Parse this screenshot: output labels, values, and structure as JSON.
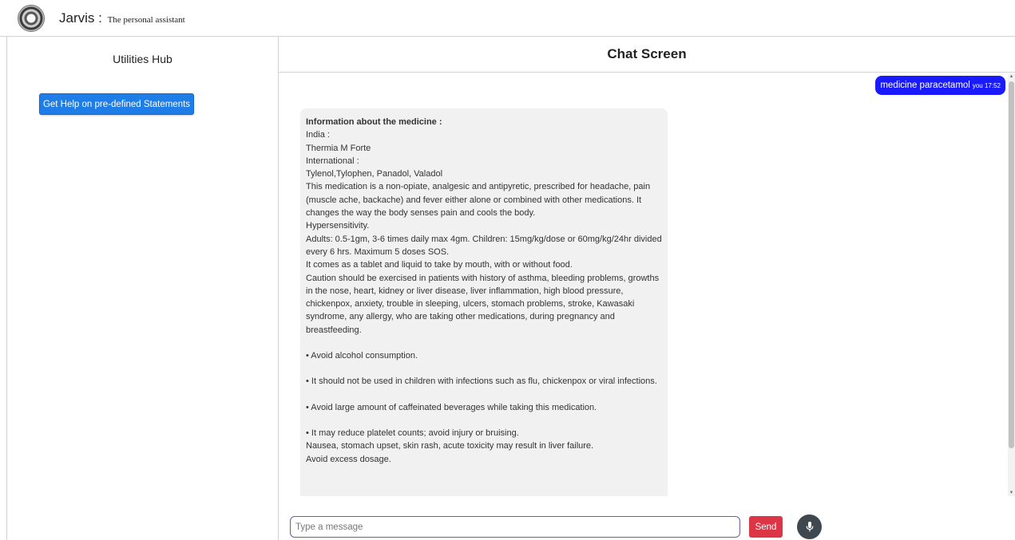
{
  "header": {
    "app_name": "Jarvis",
    "separator": " : ",
    "subtitle": "The personal assistant",
    "logo_icon": "seal-logo-icon"
  },
  "sidebar": {
    "title": "Utilities Hub",
    "help_button_label": "Get Help on pre-defined Statements"
  },
  "chat": {
    "title": "Chat Screen",
    "user_message": {
      "text": "medicine paracetamol",
      "meta": "you 17:52",
      "bubble_color": "#1a1aff"
    },
    "bot_message": {
      "lines": [
        "Information about the medicine :",
        " India :",
        "Thermia M Forte",
        "International :",
        "Tylenol,Tylophen, Panadol, Valadol",
        "This medication is a non-opiate, analgesic and antipyretic, prescribed for headache, pain",
        "(muscle ache, backache) and fever either alone or combined with other medications.  It",
        "changes the way the body senses pain and cools the body.",
        "Hypersensitivity.",
        "Adults: 0.5-1gm, 3-6 times daily max 4gm. Children: 15mg/kg/dose or 60mg/kg/24hr divided",
        "every 6 hrs. Maximum 5 doses SOS.",
        "It comes as a tablet and liquid to take by mouth, with or without food.",
        " Caution should be exercised in patients with history of asthma, bleeding problems, growths",
        "in the nose, heart, kidney or liver disease, liver inflammation, high blood pressure,",
        "chickenpox, anxiety, trouble in sleeping, ulcers, stomach problems, stroke, Kawasaki",
        "syndrome, any allergy, who are taking other medications, during pregnancy and",
        "breastfeeding.",
        "",
        "• Avoid alcohol consumption.",
        "",
        "• It should not be used in children with infections such as flu, chickenpox or viral infections.",
        "",
        "• Avoid large amount of caffeinated beverages while taking this medication.",
        "",
        "• It may reduce platelet counts; avoid injury or bruising.",
        "Nausea, stomach upset, skin rash, acute toxicity may result in liver failure.",
        "Avoid excess dosage."
      ]
    },
    "input": {
      "placeholder": "Type a message",
      "value": ""
    },
    "send_label": "Send",
    "mic_icon": "microphone-icon"
  },
  "colors": {
    "primary_button": "#1f7de8",
    "send_button": "#dc3545",
    "mic_button": "#3f474f",
    "input_border": "#6b5ea8"
  }
}
